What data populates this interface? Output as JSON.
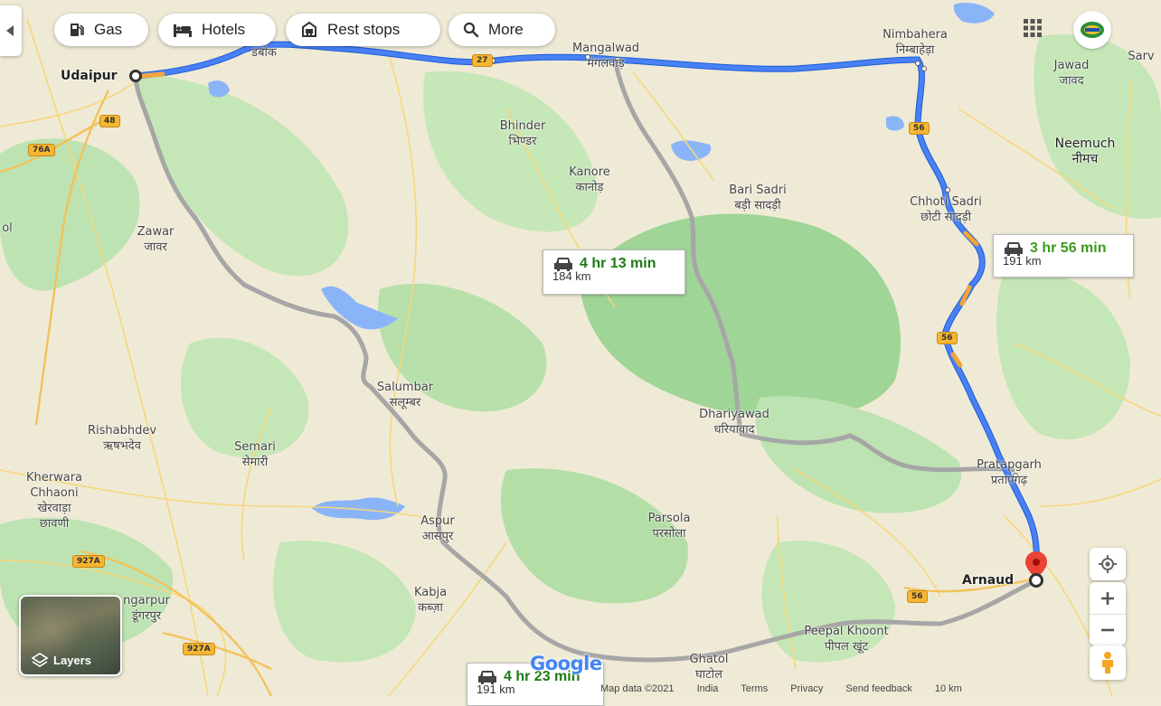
{
  "toolbar": {
    "gas_label": "Gas",
    "hotels_label": "Hotels",
    "rest_stops_label": "Rest stops",
    "more_label": "More"
  },
  "origin": {
    "name": "Udaipur"
  },
  "destination": {
    "name": "Arnaud"
  },
  "routes": [
    {
      "time": "3 hr 56 min",
      "distance": "191 km"
    },
    {
      "time": "4 hr 13 min",
      "distance": "184 km"
    },
    {
      "time": "4 hr 23 min",
      "distance": "191 km"
    }
  ],
  "places": {
    "mangalwad": "Mangalwad",
    "mangalwad_hi": "मंगलवाड़",
    "nimbahera": "Nimbahera",
    "nimbahera_hi": "निम्बाहेड़ा",
    "jawad": "Jawad",
    "jawad_hi": "जावद",
    "neemuch": "Neemuch",
    "neemuch_hi": "नीमच",
    "bhinder": "Bhinder",
    "bhinder_hi": "भिण्डर",
    "kanore": "Kanore",
    "kanore_hi": "कानोड़",
    "bari_sadri": "Bari Sadri",
    "bari_sadri_hi": "बड़ी सादड़ी",
    "chhoti_sadri": "Chhoti Sadri",
    "chhoti_sadri_hi": "छोटी सादड़ी",
    "zawar": "Zawar",
    "zawar_hi": "जावर",
    "salumbar": "Salumbar",
    "salumbar_hi": "सलूम्बर",
    "dhariyawad": "Dhariyawad",
    "dhariyawad_hi": "धरियावाद",
    "rishabhdev": "Rishabhdev",
    "rishabhdev_hi": "ऋषभदेव",
    "semari": "Semari",
    "semari_hi": "सेमारी",
    "pratapgarh": "Pratapgarh",
    "pratapgarh_hi": "प्रतापगढ़",
    "kherwara": "Kherwara",
    "kherwara2": "Chhaoni",
    "kherwara_hi": "खेरवाड़ा",
    "kherwara_hi2": "छावणी",
    "aspur": "Aspur",
    "aspur_hi": "आसपुर",
    "parsola": "Parsola",
    "parsola_hi": "परसोला",
    "kabja": "Kabja",
    "kabja_hi": "कब्ज़ा",
    "dungarpur": "ngarpur",
    "dungarpur_hi": "डूंगरपुर",
    "peepal_khoont": "Peepal Khoont",
    "peepal_khoont_hi": "पीपल खूंट",
    "ghatol": "Ghatol",
    "ghatol_hi": "घाटोल",
    "dabok": "डबोक",
    "edge_sarv": "Sarv",
    "edge_ol": "ol"
  },
  "shields": {
    "nh27": "27",
    "nh48": "48",
    "nh76a": "76A",
    "nh56a": "56",
    "nh56b": "56",
    "nh56c": "56",
    "nh927a_1": "927A",
    "nh927a_2": "927A"
  },
  "layers": {
    "label": "Layers"
  },
  "branding": {
    "logo": "Google"
  },
  "footer": {
    "map_data": "Map data ©2021",
    "india": "India",
    "terms": "Terms",
    "privacy": "Privacy",
    "send_feedback": "Send feedback",
    "scale": "10 km"
  },
  "colors": {
    "primary_route": "#4a80f5",
    "alt_route": "#a6a6a6",
    "forest": "#a8d8a0",
    "water": "#8ab4f8",
    "time_green": "#3c9a1e"
  }
}
